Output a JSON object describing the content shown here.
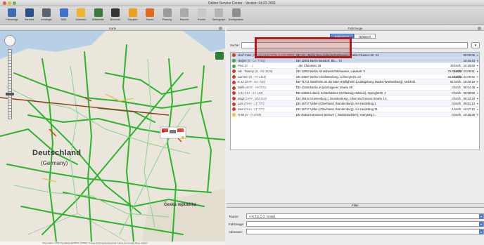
{
  "window": {
    "title": "Online Service Center - Version 14.03.2001"
  },
  "toolbar": {
    "items": [
      {
        "label": "Fahrzeuge",
        "color": "#3d6bb5"
      },
      {
        "label": "Garmins",
        "color": "#2b4f87"
      },
      {
        "label": "Anhänger",
        "color": "#596370"
      },
      {
        "label": "SMS",
        "color": "#3f72c9"
      },
      {
        "label": "Adressen",
        "color": "#f0b52b"
      },
      {
        "label": "Mitarbeiter",
        "color": "#3b7a3b"
      },
      {
        "label": "Benutzer",
        "color": "#333333"
      },
      {
        "label": "Gruppen",
        "color": "#f0a020"
      },
      {
        "label": "Touren",
        "color": "#e06a1d"
      },
      {
        "label": "Planung",
        "color": "#9a9a9a"
      },
      {
        "label": "Reports",
        "color": "#a9a9a9"
      },
      {
        "label": "Events",
        "color": "#c8c8c8"
      },
      {
        "label": "Tachograph",
        "color": "#b5b5b5"
      },
      {
        "label": "Konfiguration",
        "color": "#8f8f8f"
      }
    ]
  },
  "map_panel": {
    "title": "Karte",
    "country_label": "Deutschland",
    "country_sub": "(Germany)",
    "cz_label": "Česká republika",
    "footer": "Kartendaten ©2014 GeoBasis-DE/BKG (©2009), Google  Nutzungsbedingungen  Fehler bei Google Maps melden"
  },
  "vehicle_panel": {
    "title": "Fahrzeuge",
    "tabs": [
      "Fahrzeuge",
      "Optionen"
    ],
    "search_label": "Suche:",
    "search_value": "",
    "search_button": "▾",
    "rows": [
      {
        "status": "red",
        "name": "Wolf-Peter",
        "plate": "(B - AH 610)",
        "alert": "(LTOL 01.01.2000)",
        "address": "DE-13... Berlin Neu-Hohenschönhausen, Pablo-Picasso-Str. 23",
        "speed": "",
        "time": "00:00:06",
        "selected": true
      },
      {
        "status": "green",
        "name": "Holger",
        "plate": "(B - CT 7703)",
        "alert": "",
        "address": "DE-12681 Berlin Biesdorf, Blu... 72",
        "speed": "",
        "time": "10:26:44",
        "selected": true
      },
      {
        "status": "green",
        "name": "Post",
        "plate": "(B - ...)",
        "alert": "",
        "address": "...der Chaussee 29",
        "speed": "24 km/h",
        "time": "10:26:50",
        "selected": false
      },
      {
        "status": "red",
        "name": "AB - Tommy",
        "plate": "(B - PS 3328)",
        "alert": "",
        "address": "DE-13053 Berlin Alt-Hohenschönhausen, Lukasstr. 5",
        "speed": "0 km/h",
        "time": "31.03.2014 23:08:51",
        "selected": false
      },
      {
        "status": "red",
        "name": "Carsten",
        "plate": "(B - TT 2119)",
        "alert": "",
        "address": "DE-10587 Berlin Charlottenburg, Lohmeyerstr. 23",
        "speed": "2 km/h",
        "time": "31.03.2014 22:09:52",
        "selected": false
      },
      {
        "status": "red",
        "name": "K 12",
        "plate": "(BAR - EC 720)",
        "alert": "",
        "address": "DE-71711 Steinheim an der Murr Höpfigheim (Ludwigsburg, Baden-Württemberg), A81/E41",
        "speed": "81 km/h",
        "time": "10:26:19",
        "selected": false
      },
      {
        "status": "red",
        "name": "Beffe",
        "plate": "(BAR - ON 971)",
        "alert": "",
        "address": "DE-13158 Berlin, Kopenhagener Straße 89",
        "speed": "0 km/h",
        "time": "08:04:39",
        "selected": false
      },
      {
        "status": "red",
        "name": "A 01",
        "plate": "(HH - AA 123)",
        "alert": "",
        "address": "DE-23556 Lübeck Schönböcken (Schleswig-Holstein), Spenglerstr. 4",
        "speed": "0 km/h",
        "time": "08:59:58",
        "selected": false
      },
      {
        "status": "red",
        "name": "Birgit",
        "plate": "(OHV - BM 910)",
        "alert": "",
        "address": "DE-16515 Oranienburg (, Brandenburg), Albert-Buchmann-Straße 1A",
        "speed": "0 km/h",
        "time": "08:33:20",
        "selected": false
      },
      {
        "status": "red",
        "name": "Lars",
        "plate": "(OHV - LT 777)",
        "alert": "",
        "address": "DE-16727 Velten (Oberhavel, Brandenburg), Am Heidekrug 1",
        "speed": "0 km/h",
        "time": "09:51:14",
        "selected": false
      },
      {
        "status": "red",
        "name": "Susi",
        "plate": "(OHV - LT 777)",
        "alert": "",
        "address": "DE-16727 Velten (Oberhavel, Brandenburg), Am Heidekrug 31",
        "speed": "1 km/h",
        "time": "10:07:10",
        "selected": false
      },
      {
        "status": "yellow",
        "name": "H 60",
        "plate": "(H - O 6789)",
        "alert": "",
        "address": "DE-30453 Hannover Bornum (, Niedersachsen), Harryweg 1",
        "speed": "0 km/h",
        "time": "10:26:39",
        "selected": false
      }
    ]
  },
  "filter": {
    "title": "Filter",
    "tours_label": "Touren:",
    "tours_value": "A.R.T.E.C.O. GmbH",
    "vehicles_label": "Fahrzeuge:",
    "vehicles_value": "",
    "addresses_label": "Adressen:",
    "addresses_value": ""
  },
  "colors": {
    "highlight": "#b21a1a",
    "route": "#2db32d",
    "tab_active": "#3c7ad0"
  }
}
